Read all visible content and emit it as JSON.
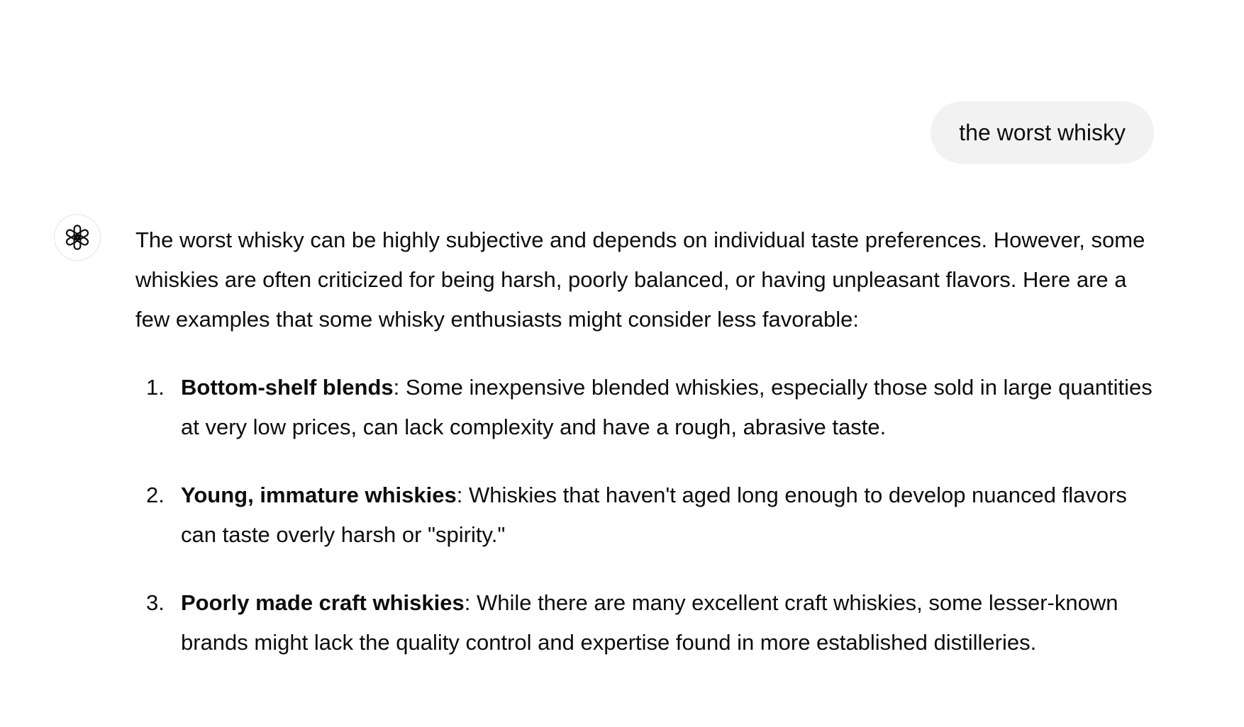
{
  "conversation": {
    "user_message": "the worst whisky",
    "assistant": {
      "avatar_icon": "openai-logo-icon",
      "intro": "The worst whisky can be highly subjective and depends on individual taste preferences. However, some whiskies are often criticized for being harsh, poorly balanced, or having unpleasant flavors. Here are a few examples that some whisky enthusiasts might consider less favorable:",
      "items": [
        {
          "number": "1.",
          "title": "Bottom-shelf blends",
          "text": ": Some inexpensive blended whiskies, especially those sold in large quantities at very low prices, can lack complexity and have a rough, abrasive taste."
        },
        {
          "number": "2.",
          "title": "Young, immature whiskies",
          "text": ": Whiskies that haven't aged long enough to develop nuanced flavors can taste overly harsh or \"spirity.\""
        },
        {
          "number": "3.",
          "title": "Poorly made craft whiskies",
          "text": ": While there are many excellent craft whiskies, some lesser-known brands might lack the quality control and expertise found in more established distilleries."
        }
      ]
    }
  },
  "colors": {
    "background": "#ffffff",
    "user_bubble": "#f2f2f2",
    "text": "#0d0d0d",
    "avatar_border": "#e3e3e3"
  }
}
